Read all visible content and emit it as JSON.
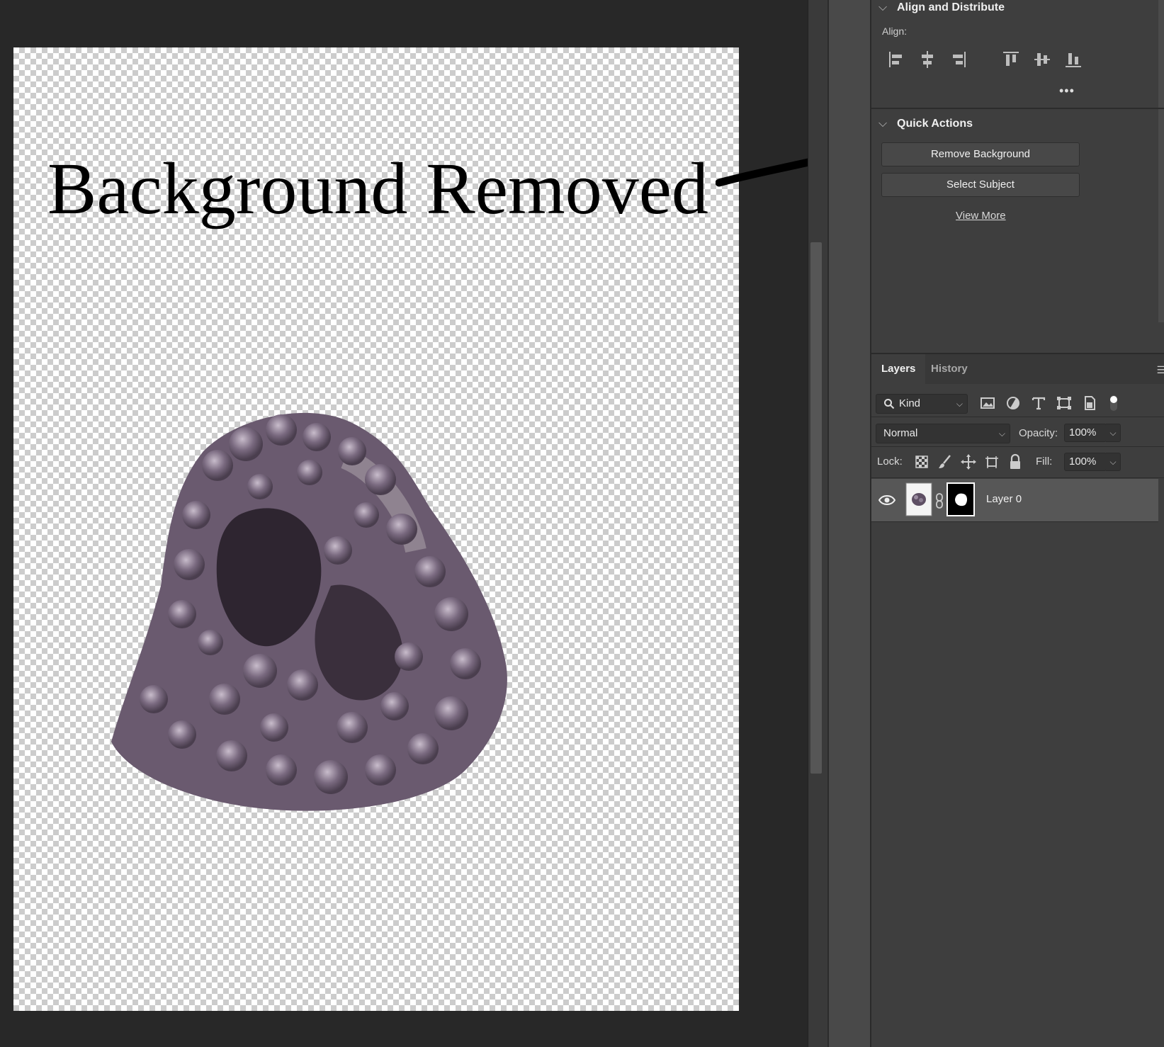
{
  "canvas": {
    "overlay_text": "Background Removed",
    "colors": {
      "checker_light": "#ffffff",
      "checker_dark": "#cccccc",
      "workspace_bg": "#282828"
    }
  },
  "align_panel": {
    "title": "Align and Distribute",
    "align_label": "Align:",
    "icons": [
      "align-left-edges-icon",
      "align-horizontal-centers-icon",
      "align-right-edges-icon",
      "align-top-edges-icon",
      "align-vertical-centers-icon",
      "align-bottom-edges-icon"
    ],
    "more": "•••"
  },
  "quick_actions": {
    "title": "Quick Actions",
    "buttons": [
      "Remove Background",
      "Select Subject"
    ],
    "view_more": "View More"
  },
  "layers_panel": {
    "tabs": [
      "Layers",
      "History"
    ],
    "filter": {
      "kind_label": "Kind",
      "icons": [
        "pixel-layer-filter-icon",
        "adjustment-layer-filter-icon",
        "type-layer-filter-icon",
        "shape-layer-filter-icon",
        "smart-object-filter-icon",
        "filter-toggle-icon"
      ]
    },
    "blend_mode": "Normal",
    "opacity_label": "Opacity:",
    "opacity_value": "100%",
    "lock_label": "Lock:",
    "fill_label": "Fill:",
    "fill_value": "100%",
    "layers": [
      {
        "name": "Layer 0",
        "visible": true,
        "has_mask": true
      }
    ]
  }
}
